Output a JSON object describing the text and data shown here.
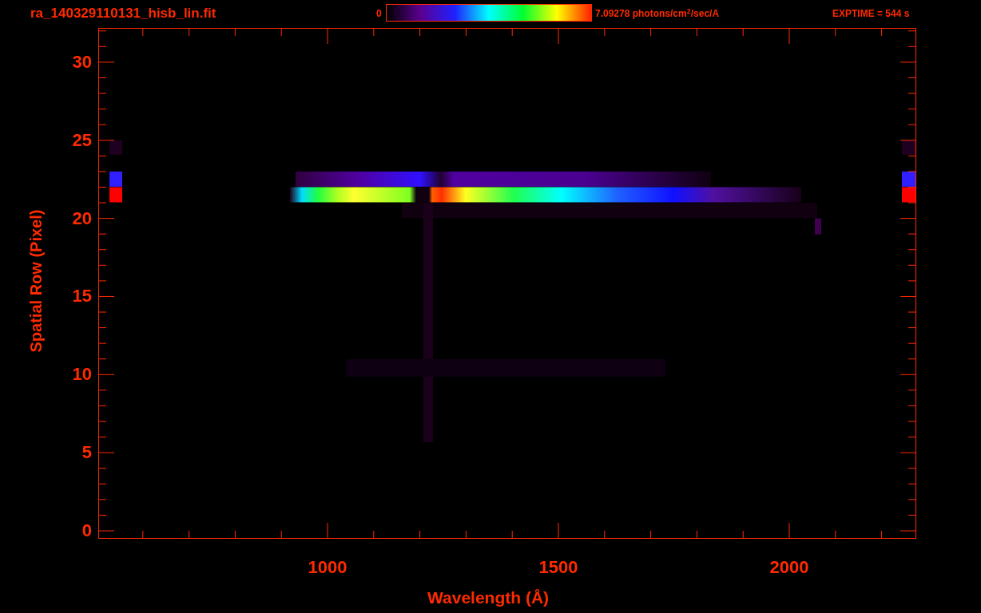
{
  "header": {
    "filename": "ra_140329110131_hisb_lin.fit",
    "colorbar_min": "0",
    "colorbar_max": "7.09278 photons/cm$^{2}$/sec/A",
    "exptime": "EXPTIME = 544 s"
  },
  "y_axis": {
    "label": "Spatial Row (Pixel)",
    "ticks": [
      "30",
      "25",
      "20",
      "15",
      "10",
      "5",
      "0"
    ]
  },
  "x_axis": {
    "label": "Wavelength (Å)",
    "ticks": [
      "1000",
      "1500",
      "2000"
    ]
  }
}
